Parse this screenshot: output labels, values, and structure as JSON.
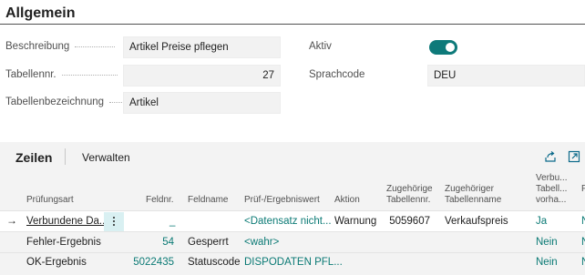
{
  "header": {
    "title": "Allgemein"
  },
  "fields": {
    "beschreibung": {
      "label": "Beschreibung",
      "value": "Artikel Preise pflegen"
    },
    "tabellennr": {
      "label": "Tabellennr.",
      "value": "27"
    },
    "tabellenbezeichnung": {
      "label": "Tabellenbezeichnung",
      "value": "Artikel"
    },
    "aktiv": {
      "label": "Aktiv",
      "value": true
    },
    "sprachcode": {
      "label": "Sprachcode",
      "value": "DEU"
    }
  },
  "lines": {
    "title": "Zeilen",
    "manage_label": "Verwalten",
    "icons": [
      "share-icon",
      "open-in-new-window-icon"
    ],
    "columns": {
      "pruefungsart": "Prüfungsart",
      "feldnr": "Feldnr.",
      "feldname": "Feldname",
      "pruef": "Prüf-/Ergebniswert",
      "aktion": "Aktion",
      "zug_nr_1": "Zugehörige",
      "zug_nr_2": "Tabellennr.",
      "zug_name_1": "Zugehöriger",
      "zug_name_2": "Tabellenname",
      "verbu_1": "Verbu...",
      "verbu_2": "Tabell...",
      "verbu_3": "vorha...",
      "extra": "F"
    },
    "rows": [
      {
        "pruefungsart": "Verbundene Da...",
        "feldnr": "_",
        "feldname": "",
        "pruef": "<Datensatz nicht...",
        "aktion": "Warnung",
        "zug_nr": "5059607",
        "zug_name": "Verkaufspreis",
        "verbu": "Ja",
        "extra": "N"
      },
      {
        "pruefungsart": "Fehler-Ergebnis",
        "feldnr": "54",
        "feldname": "Gesperrt",
        "pruef": "<wahr>",
        "aktion": "",
        "zug_nr": "",
        "zug_name": "",
        "verbu": "Nein",
        "extra": "N"
      },
      {
        "pruefungsart": "OK-Ergebnis",
        "feldnr": "5022435",
        "feldname": "Statuscode",
        "pruef": "DISPODATEN PFL...",
        "aktion": "",
        "zug_nr": "",
        "zug_name": "",
        "verbu": "Nein",
        "extra": "N"
      }
    ]
  },
  "colors": {
    "accent": "#0e7a7a",
    "link": "#0b7a75",
    "selected": "#d9f0f2"
  }
}
